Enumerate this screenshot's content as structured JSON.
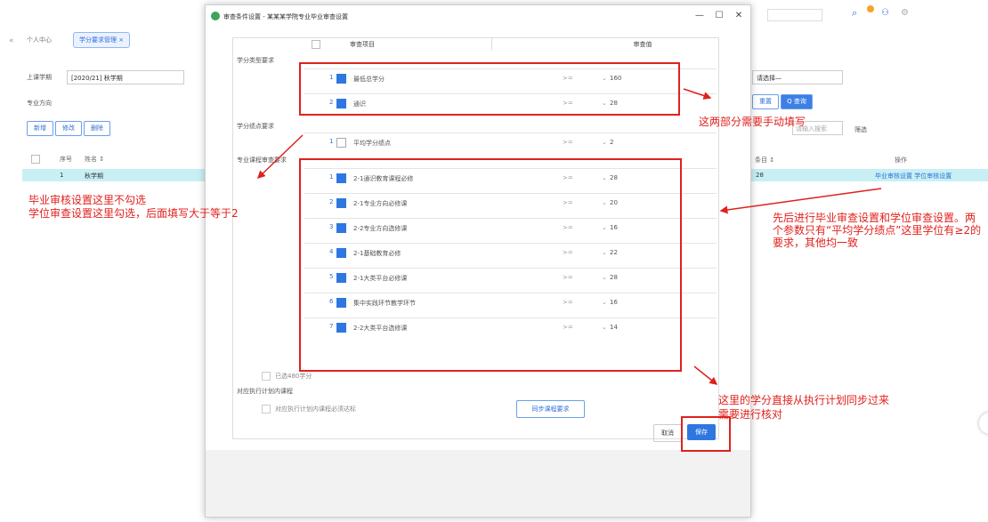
{
  "bg": {
    "home_tab": "个人中心",
    "active_tab": "学分要求管理 ×",
    "label1": "上课学期",
    "select1": "[2020/21] 秋学期",
    "label2": "专业方向",
    "btn1": "新增",
    "btn2": "修改",
    "btn3": "删除",
    "col_no": "序号",
    "col_name": "姓名 ↕",
    "row_no": "1",
    "row_name": "秋学期",
    "right_select": "请选择—",
    "right_btn_reset": "重置",
    "right_btn_query": "Q 查询",
    "right_search": "请输入搜索",
    "right_filter": "筛选",
    "right_col1": "条目 ↕",
    "right_col2": "操作",
    "right_val": "28",
    "right_ops": "毕业审核设置  学位审核设置"
  },
  "modal": {
    "title": "审查条件设置 - 某某某学院专业毕业审查设置",
    "col_item": "审查项目",
    "col_value": "审查值",
    "section1": "学分类型要求",
    "section2": "学分绩点要求",
    "section3": "专业课程审查要求",
    "rows_a": [
      {
        "num": "1",
        "item": "最低总学分",
        "op": ">=",
        "val": "160"
      },
      {
        "num": "2",
        "item": "通识",
        "op": ">=",
        "val": "28"
      }
    ],
    "rows_b": [
      {
        "num": "1",
        "item": "平均学分绩点",
        "op": ">=",
        "val": "2"
      }
    ],
    "rows_c": [
      {
        "num": "1",
        "item": "2-1通识教育课程必修",
        "op": ">=",
        "val": "28"
      },
      {
        "num": "2",
        "item": "2-1专业方向必修课",
        "op": ">=",
        "val": "20"
      },
      {
        "num": "3",
        "item": "2-2专业方向选修课",
        "op": ">=",
        "val": "16"
      },
      {
        "num": "4",
        "item": "2-1基础教育必修",
        "op": ">=",
        "val": "22"
      },
      {
        "num": "5",
        "item": "2-1大类平台必修课",
        "op": ">=",
        "val": "28"
      },
      {
        "num": "6",
        "item": "集中实践环节教学环节",
        "op": ">=",
        "val": "16"
      },
      {
        "num": "7",
        "item": "2-2大类平台选修课",
        "op": ">=",
        "val": "14"
      }
    ],
    "check_total": "已选480学分",
    "section4": "对应执行计划内课程",
    "exec_label": "对应执行计划内课程必须达标",
    "sync_button": "同步课程要求",
    "cancel": "取消",
    "save": "保存"
  },
  "annotations": {
    "a1": "这两部分需要手动填写",
    "a2_line1": "毕业审核设置这里不勾选",
    "a2_line2": "学位审查设置这里勾选，后面填写大于等于2",
    "a3": "先后进行毕业审查设置和学位审查设置。两个参数只有“平均学分绩点”这里学位有≥2的要求，其他均一致",
    "a4_line1": "这里的学分直接从执行计划同步过来",
    "a4_line2": "需要进行核对"
  },
  "colors": {
    "accent": "#2f77e0",
    "annotation": "#e0211d",
    "highlight_row": "#c8f0f4"
  }
}
